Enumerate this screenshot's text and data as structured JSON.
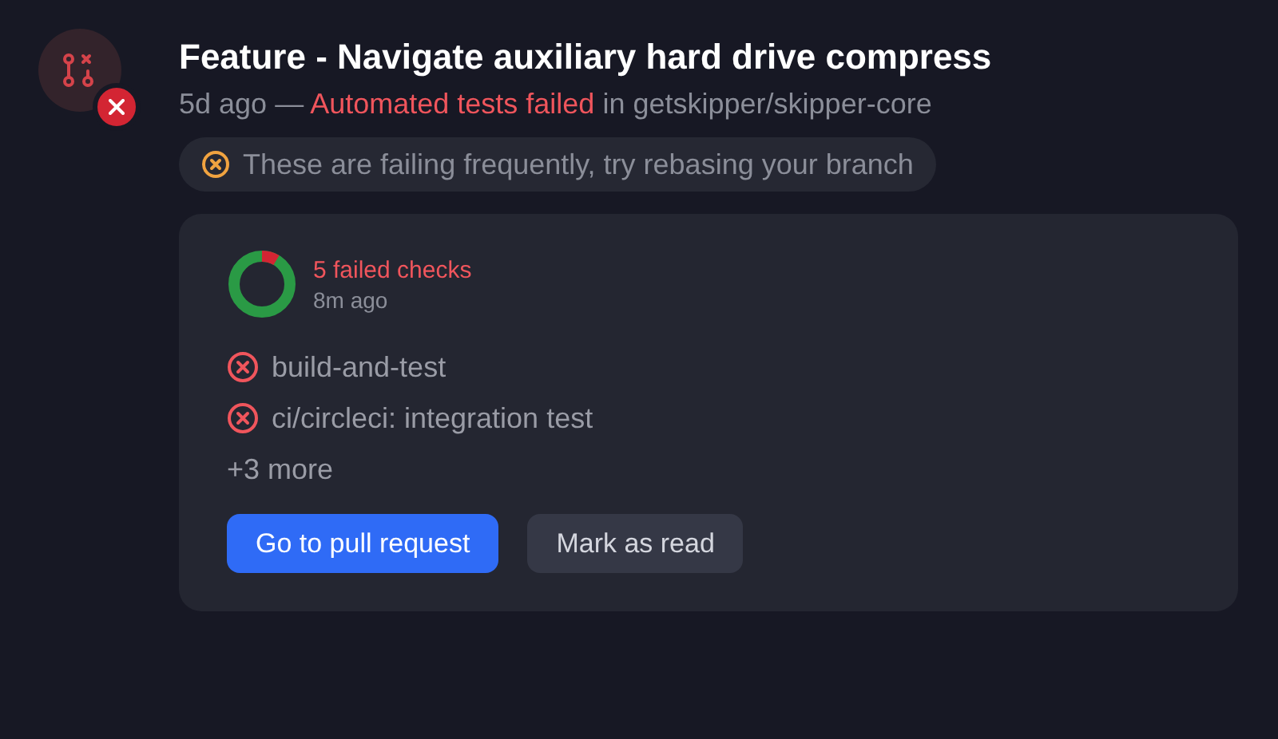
{
  "notification": {
    "title": "Feature - Navigate auxiliary hard drive compress",
    "time": "5d ago",
    "separator": "—",
    "status": "Automated tests failed",
    "connector": "in",
    "repository": "getskipper/skipper-core"
  },
  "hint": {
    "text": "These are failing frequently, try rebasing your branch"
  },
  "checks": {
    "summary": "5 failed checks",
    "time": "8m ago",
    "items": [
      {
        "name": "build-and-test"
      },
      {
        "name": "ci/circleci: integration test"
      }
    ],
    "more": "+3 more"
  },
  "buttons": [
    {
      "label": "Go to pull request",
      "kind": "primary"
    },
    {
      "label": "Mark as read",
      "kind": "secondary"
    }
  ]
}
